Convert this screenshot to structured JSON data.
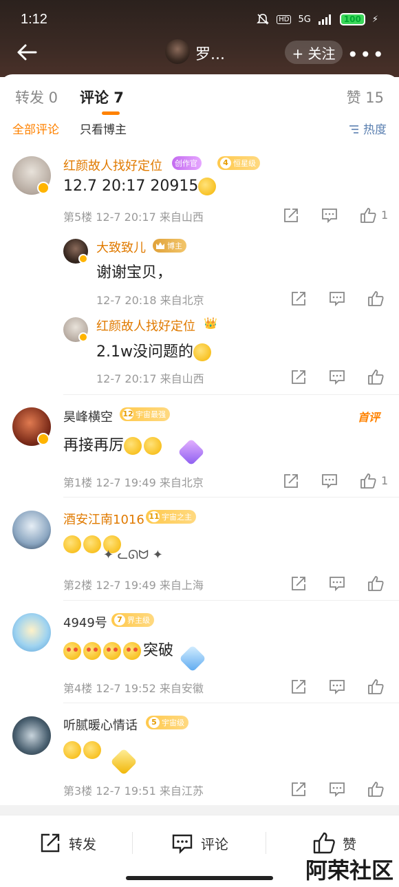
{
  "status_bar": {
    "time": "1:12",
    "network": "5G",
    "battery": "100"
  },
  "nav": {
    "title": "罗...",
    "follow_label": "+ 关注",
    "more": "•••"
  },
  "tabs": {
    "repost": "转发 0",
    "comment": "评论 7",
    "like": "赞 15"
  },
  "filters": {
    "all": "全部评论",
    "owner_only": "只看博主",
    "sort": "热度"
  },
  "comments": [
    {
      "name": "红颜故人找好定位",
      "badge1": "创作官",
      "badge2": "恒星级",
      "badge2_level": "4",
      "text": "12.7 20:17  20915",
      "meta": "第5楼  12-7 20:17  来自山西",
      "likes": "1",
      "replies": [
        {
          "name": "大致致儿",
          "badge": "博主",
          "text": "谢谢宝贝，",
          "meta": "12-7 20:18  来自北京"
        },
        {
          "name": "红颜故人找好定位",
          "text": "2.1w没问题的",
          "meta": "12-7 20:17  来自山西"
        }
      ]
    },
    {
      "name": "昊峰横空",
      "badge": "宇宙最强",
      "badge_level": "12",
      "first_pick": "首评",
      "text": "再接再厉",
      "meta": "第1楼  12-7 19:49  来自北京",
      "likes": "1"
    },
    {
      "name": "酒安江南1016",
      "badge": "宇宙之主",
      "badge_level": "11",
      "text": "",
      "meta": "第2楼  12-7 19:49  来自上海"
    },
    {
      "name": "4949号",
      "badge": "界主级",
      "badge_level": "7",
      "text": "突破",
      "meta": "第4楼  12-7 19:52  来自安徽"
    },
    {
      "name": "听腻暖心情话",
      "badge": "宇宙级",
      "badge_level": "5",
      "text": "",
      "meta": "第3楼  12-7 19:51  来自江苏"
    }
  ],
  "bottom": {
    "repost": "转发",
    "comment": "评论",
    "like": "赞"
  },
  "watermark": "阿荣社区",
  "colors": {
    "accent": "#ff8200",
    "link": "#5a7fb0",
    "header_bg": "#3b2a24"
  }
}
